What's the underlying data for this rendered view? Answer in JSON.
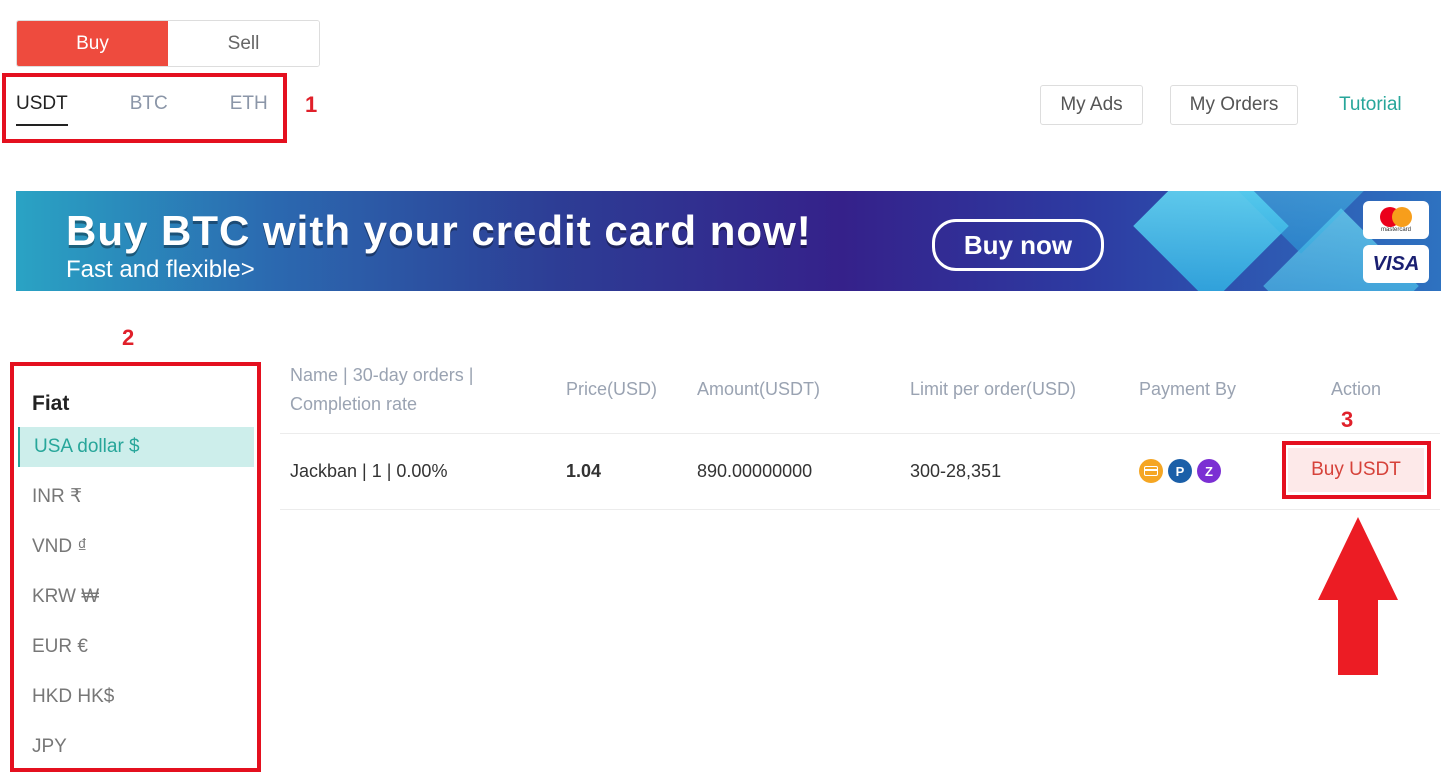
{
  "trade_toggle": {
    "buy": "Buy",
    "sell": "Sell"
  },
  "coin_tabs": [
    "USDT",
    "BTC",
    "ETH"
  ],
  "top_actions": {
    "my_ads": "My Ads",
    "my_orders": "My Orders",
    "tutorial": "Tutorial"
  },
  "banner": {
    "title": "Buy BTC with your credit card now!",
    "subtitle": "Fast and flexible>",
    "button": "Buy now",
    "card_visa": "VISA",
    "card_mastercard": "mastercard"
  },
  "annotations": [
    "1",
    "2",
    "3"
  ],
  "sidebar": {
    "title": "Fiat",
    "items": [
      "USA dollar $",
      "INR ₹",
      "VND ₫",
      "KRW ₩",
      "EUR €",
      "HKD HK$",
      "JPY"
    ]
  },
  "table": {
    "headers": {
      "name": "Name | 30-day orders | Completion rate",
      "price": "Price(USD)",
      "amount": "Amount(USDT)",
      "limit": "Limit per order(USD)",
      "payment": "Payment By",
      "action": "Action"
    },
    "rows": [
      {
        "name": "Jackban | 1 | 0.00%",
        "price": "1.04",
        "amount": "890.00000000",
        "limit": "300-28,351",
        "payment_icons": [
          "card-payment-icon",
          "paypal-icon",
          "zelle-icon"
        ],
        "action": "Buy USDT"
      }
    ]
  },
  "colors": {
    "accent_red": "#ee4b3e",
    "accent_teal": "#27a69a",
    "annotation_red": "#e4101f"
  }
}
